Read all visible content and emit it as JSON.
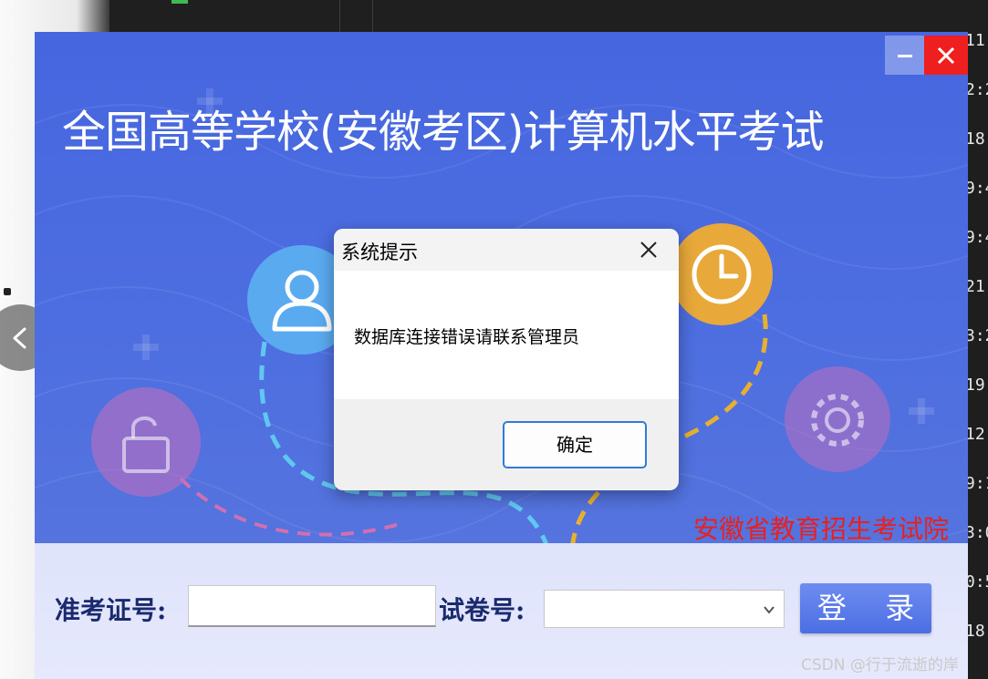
{
  "background": {
    "timestamps": [
      "11:",
      "2:2",
      "18:",
      "9:4",
      "9:4",
      "21:",
      "3:2",
      "19:",
      "12:",
      "9:1",
      "3:0",
      "0:5",
      "18:"
    ]
  },
  "login_window": {
    "title": "全国高等学校(安徽考区)计算机水平考试",
    "organization": "安徽省教育招生考试院",
    "ticket_label": "准考证号:",
    "ticket_value": "",
    "paper_label": "试卷号:",
    "paper_value": "",
    "login_button": "登 录",
    "colors": {
      "background": "#4666e0",
      "close": "#ef1f1f",
      "organization": "#e82020",
      "label": "#1a2a6e"
    }
  },
  "dialog": {
    "title": "系统提示",
    "message": "数据库连接错误请联系管理员",
    "ok_label": "确定"
  },
  "watermark": "CSDN @行于流逝的岸",
  "icons": [
    "back-chevron-icon",
    "close-icon",
    "minimize-icon",
    "user-icon",
    "clock-icon",
    "unlock-icon",
    "gear-icon",
    "chevron-down-icon"
  ]
}
